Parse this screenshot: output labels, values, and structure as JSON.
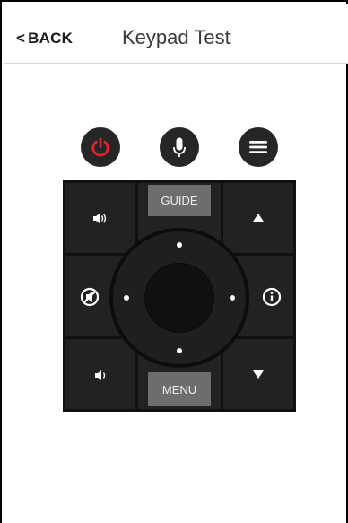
{
  "header": {
    "back_chevron": "<",
    "back_label": "BACK",
    "title": "Keypad Test"
  },
  "top_buttons": [
    {
      "name": "power",
      "icon": "power-icon",
      "color": "#d9262c"
    },
    {
      "name": "voice",
      "icon": "microphone-icon",
      "color": "#ffffff"
    },
    {
      "name": "options",
      "icon": "hamburger-menu-icon",
      "color": "#ffffff"
    }
  ],
  "keypad": {
    "guide_label": "GUIDE",
    "menu_label": "MENU",
    "volume_up_icon": "volume-up-icon",
    "volume_down_icon": "volume-down-icon",
    "channel_up_icon": "channel-up-arrow-icon",
    "channel_down_icon": "channel-down-arrow-icon",
    "mute_icon": "no-sound-icon",
    "info_icon": "info-icon"
  },
  "colors": {
    "pad_background": "#101010",
    "key_background": "#222222",
    "label_key_background": "#6d6d6d",
    "power_red": "#d9262c"
  }
}
